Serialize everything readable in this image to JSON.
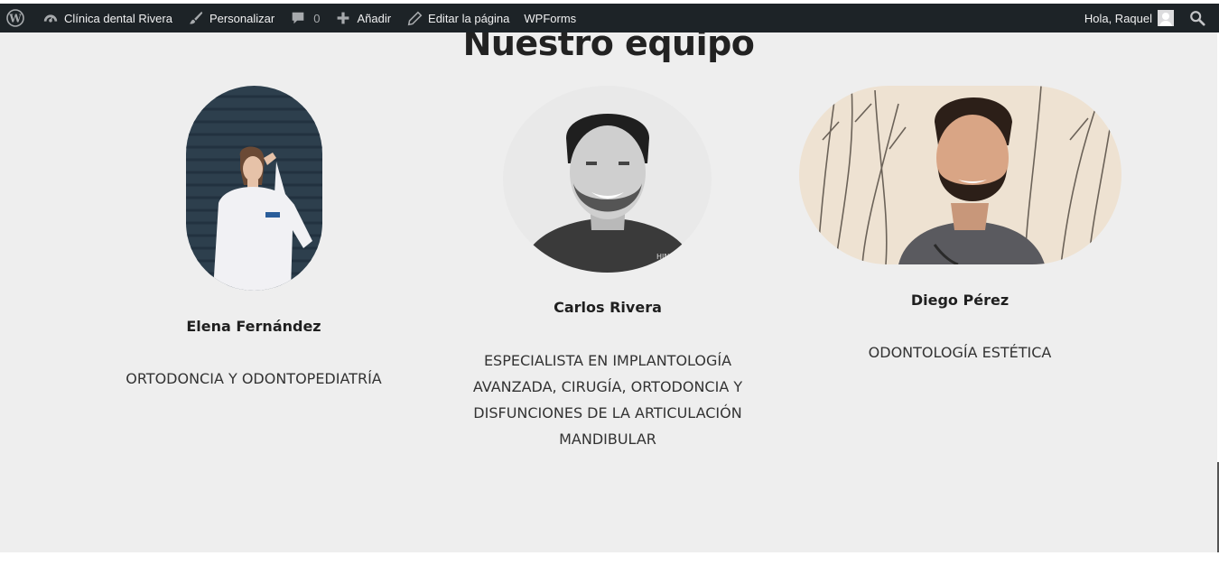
{
  "admin_bar": {
    "site_name": "Clínica dental Rivera",
    "customize": "Personalizar",
    "comments_count": "0",
    "add_new": "Añadir",
    "edit_page": "Editar la página",
    "wpforms": "WPForms",
    "greeting": "Hola, Raquel",
    "icons": [
      "wordpress-logo-icon",
      "dashboard-icon",
      "brush-icon",
      "comment-icon",
      "plus-icon",
      "pencil-icon",
      "search-icon"
    ]
  },
  "section": {
    "title": "Nuestro equipo"
  },
  "team": [
    {
      "name": "Elena Fernández",
      "role": "ORTODONCIA Y ODONTOPEDIATRÍA"
    },
    {
      "name": "Carlos Rivera",
      "role": "ESPECIALISTA EN IMPLANTOLOGÍA AVANZADA, CIRUGÍA, ORTODONCIA Y DISFUNCIONES DE LA ARTICULACIÓN MANDIBULAR"
    },
    {
      "name": "Diego Pérez",
      "role": "ODONTOLOGÍA ESTÉTICA"
    }
  ],
  "colors": {
    "admin_bar_bg": "#1d2327",
    "page_bg": "#eeeeee",
    "heading": "#222222"
  }
}
